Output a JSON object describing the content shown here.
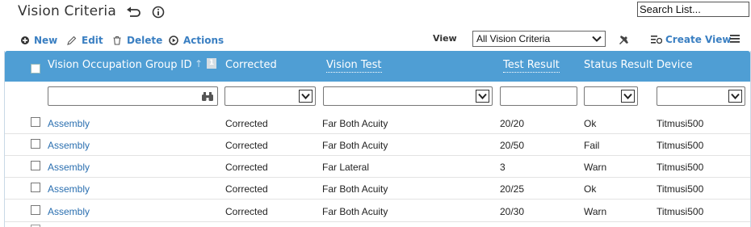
{
  "page": {
    "title": "Vision Criteria",
    "title_icons": [
      "undo-arrow-icon",
      "info-icon"
    ],
    "search_placeholder": "Search List..."
  },
  "toolbar": {
    "new_label": "New",
    "edit_label": "Edit",
    "delete_label": "Delete",
    "actions_label": "Actions",
    "view_label": "View",
    "view_selected": "All Vision Criteria",
    "create_view_label": "Create View",
    "accent_color": "#3a7fc2"
  },
  "grid": {
    "header_color": "#4f9ed4",
    "sort_badge": "1",
    "columns": [
      {
        "label": "Vision Occupation Group ID",
        "sortable": false
      },
      {
        "label": "Corrected",
        "sortable": false
      },
      {
        "label": "Vision Test",
        "sortable": true
      },
      {
        "label": "Test Result",
        "sortable": true
      },
      {
        "label": "Status Result",
        "sortable": false
      },
      {
        "label": "Device",
        "sortable": false
      }
    ],
    "rows": [
      {
        "group": "Assembly",
        "corrected": "Corrected",
        "test": "Far Both Acuity",
        "result": "20/20",
        "status": "Ok",
        "device": "Titmusi500"
      },
      {
        "group": "Assembly",
        "corrected": "Corrected",
        "test": "Far Both Acuity",
        "result": "20/50",
        "status": "Fail",
        "device": "Titmusi500"
      },
      {
        "group": "Assembly",
        "corrected": "Corrected",
        "test": "Far Lateral",
        "result": "3",
        "status": "Warn",
        "device": "Titmusi500"
      },
      {
        "group": "Assembly",
        "corrected": "Corrected",
        "test": "Far Both Acuity",
        "result": "20/25",
        "status": "Ok",
        "device": "Titmusi500"
      },
      {
        "group": "Assembly",
        "corrected": "Corrected",
        "test": "Far Both Acuity",
        "result": "20/30",
        "status": "Warn",
        "device": "Titmusi500"
      }
    ]
  }
}
